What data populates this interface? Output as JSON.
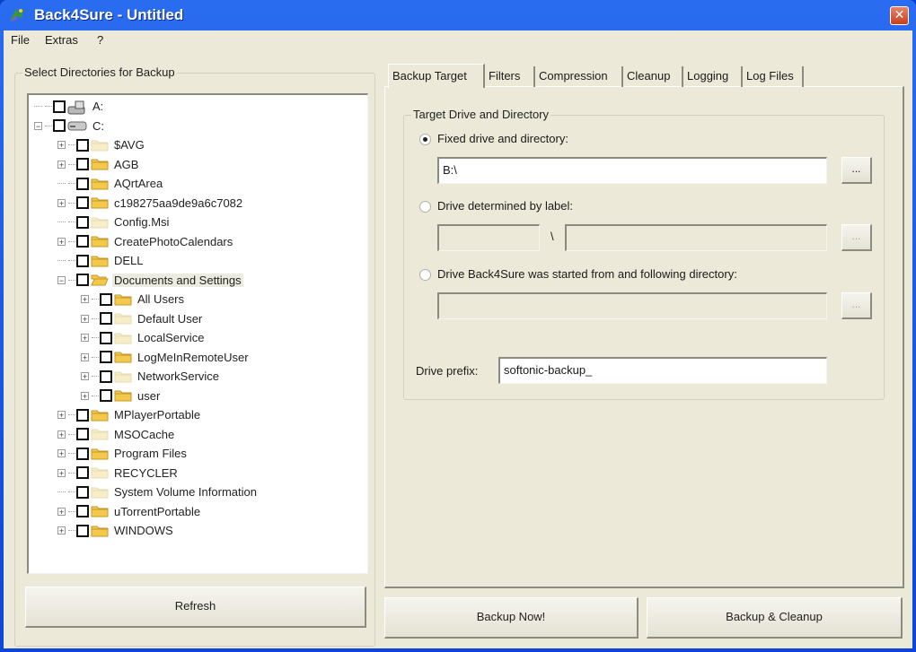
{
  "window": {
    "title": "Back4Sure - Untitled",
    "close_glyph": "✕"
  },
  "menu": [
    {
      "label": "File"
    },
    {
      "label": "Extras"
    },
    {
      "label": "?"
    }
  ],
  "left_panel": {
    "group_title": "Select Directories for Backup",
    "refresh_label": "Refresh",
    "tree": [
      {
        "label": "A:",
        "level": 0,
        "icon": "floppy-drive-icon",
        "expander": "none",
        "checked": false
      },
      {
        "label": "C:",
        "level": 0,
        "icon": "hard-drive-icon",
        "expander": "minus",
        "checked": false
      },
      {
        "label": "$AVG",
        "level": 1,
        "icon": "folder-hidden-icon",
        "expander": "plus",
        "checked": false
      },
      {
        "label": "AGB",
        "level": 1,
        "icon": "folder-icon",
        "expander": "plus",
        "checked": false
      },
      {
        "label": "AQrtArea",
        "level": 1,
        "icon": "folder-icon",
        "expander": "none",
        "checked": false
      },
      {
        "label": "c198275aa9de9a6c7082",
        "level": 1,
        "icon": "folder-icon",
        "expander": "plus",
        "checked": false
      },
      {
        "label": "Config.Msi",
        "level": 1,
        "icon": "folder-hidden-icon",
        "expander": "none",
        "checked": false
      },
      {
        "label": "CreatePhotoCalendars",
        "level": 1,
        "icon": "folder-icon",
        "expander": "plus",
        "checked": false
      },
      {
        "label": "DELL",
        "level": 1,
        "icon": "folder-icon",
        "expander": "none",
        "checked": false
      },
      {
        "label": "Documents and Settings",
        "level": 1,
        "icon": "folder-open-icon",
        "expander": "minus",
        "checked": false,
        "selected": true
      },
      {
        "label": "All Users",
        "level": 2,
        "icon": "folder-icon",
        "expander": "plus",
        "checked": false
      },
      {
        "label": "Default User",
        "level": 2,
        "icon": "folder-hidden-icon",
        "expander": "plus",
        "checked": false
      },
      {
        "label": "LocalService",
        "level": 2,
        "icon": "folder-hidden-icon",
        "expander": "plus",
        "checked": false
      },
      {
        "label": "LogMeInRemoteUser",
        "level": 2,
        "icon": "folder-icon",
        "expander": "plus",
        "checked": false
      },
      {
        "label": "NetworkService",
        "level": 2,
        "icon": "folder-hidden-icon",
        "expander": "plus",
        "checked": false
      },
      {
        "label": "user",
        "level": 2,
        "icon": "folder-icon",
        "expander": "plus",
        "checked": false
      },
      {
        "label": "MPlayerPortable",
        "level": 1,
        "icon": "folder-icon",
        "expander": "plus",
        "checked": false
      },
      {
        "label": "MSOCache",
        "level": 1,
        "icon": "folder-hidden-icon",
        "expander": "plus",
        "checked": false
      },
      {
        "label": "Program Files",
        "level": 1,
        "icon": "folder-icon",
        "expander": "plus",
        "checked": false
      },
      {
        "label": "RECYCLER",
        "level": 1,
        "icon": "folder-hidden-icon",
        "expander": "plus",
        "checked": false
      },
      {
        "label": "System Volume Information",
        "level": 1,
        "icon": "folder-hidden-icon",
        "expander": "none",
        "checked": false
      },
      {
        "label": "uTorrentPortable",
        "level": 1,
        "icon": "folder-icon",
        "expander": "plus",
        "checked": false
      },
      {
        "label": "WINDOWS",
        "level": 1,
        "icon": "folder-icon",
        "expander": "plus",
        "checked": false
      }
    ]
  },
  "tabs": [
    {
      "label": "Backup Target",
      "active": true
    },
    {
      "label": "Filters"
    },
    {
      "label": "Compression"
    },
    {
      "label": "Cleanup"
    },
    {
      "label": "Logging"
    },
    {
      "label": "Log Files"
    }
  ],
  "backup_target": {
    "group_title": "Target Drive and Directory",
    "option_fixed": {
      "label": "Fixed drive and directory:",
      "checked": true,
      "value": "B:\\"
    },
    "option_label": {
      "label": "Drive determined by label:",
      "checked": false,
      "label_value": "",
      "separator": "\\",
      "dir_value": ""
    },
    "option_started": {
      "label": "Drive Back4Sure was started from and following directory:",
      "checked": false,
      "value": ""
    },
    "browse_label": "...",
    "drive_prefix_label": "Drive prefix:",
    "drive_prefix_value": "softonic-backup_"
  },
  "actions": {
    "backup_now": "Backup Now!",
    "backup_cleanup": "Backup & Cleanup"
  }
}
